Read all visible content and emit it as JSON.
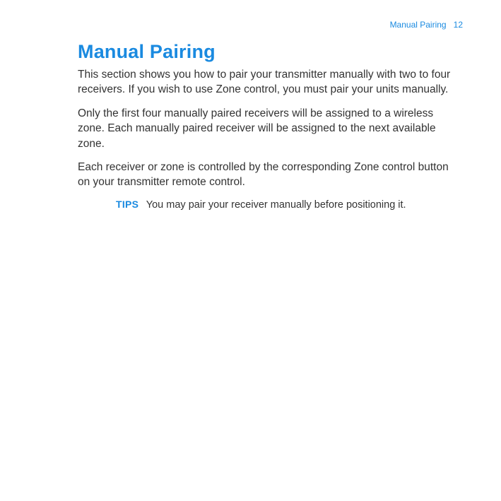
{
  "header": {
    "section_name": "Manual Pairing",
    "page_number": "12"
  },
  "title": "Manual Pairing",
  "paragraphs": [
    "This section shows you how to pair your transmitter manually with two to four receivers. If you wish to use Zone control, you must pair your units manually.",
    "Only the first four manually paired receivers will be assigned to a wireless zone. Each manually paired receiver will be assigned to the next available zone.",
    "Each receiver or zone is controlled by the corresponding Zone control button on your transmitter remote control."
  ],
  "tips": {
    "label": "TIPS",
    "text": "You may pair your receiver manually before positioning it."
  }
}
